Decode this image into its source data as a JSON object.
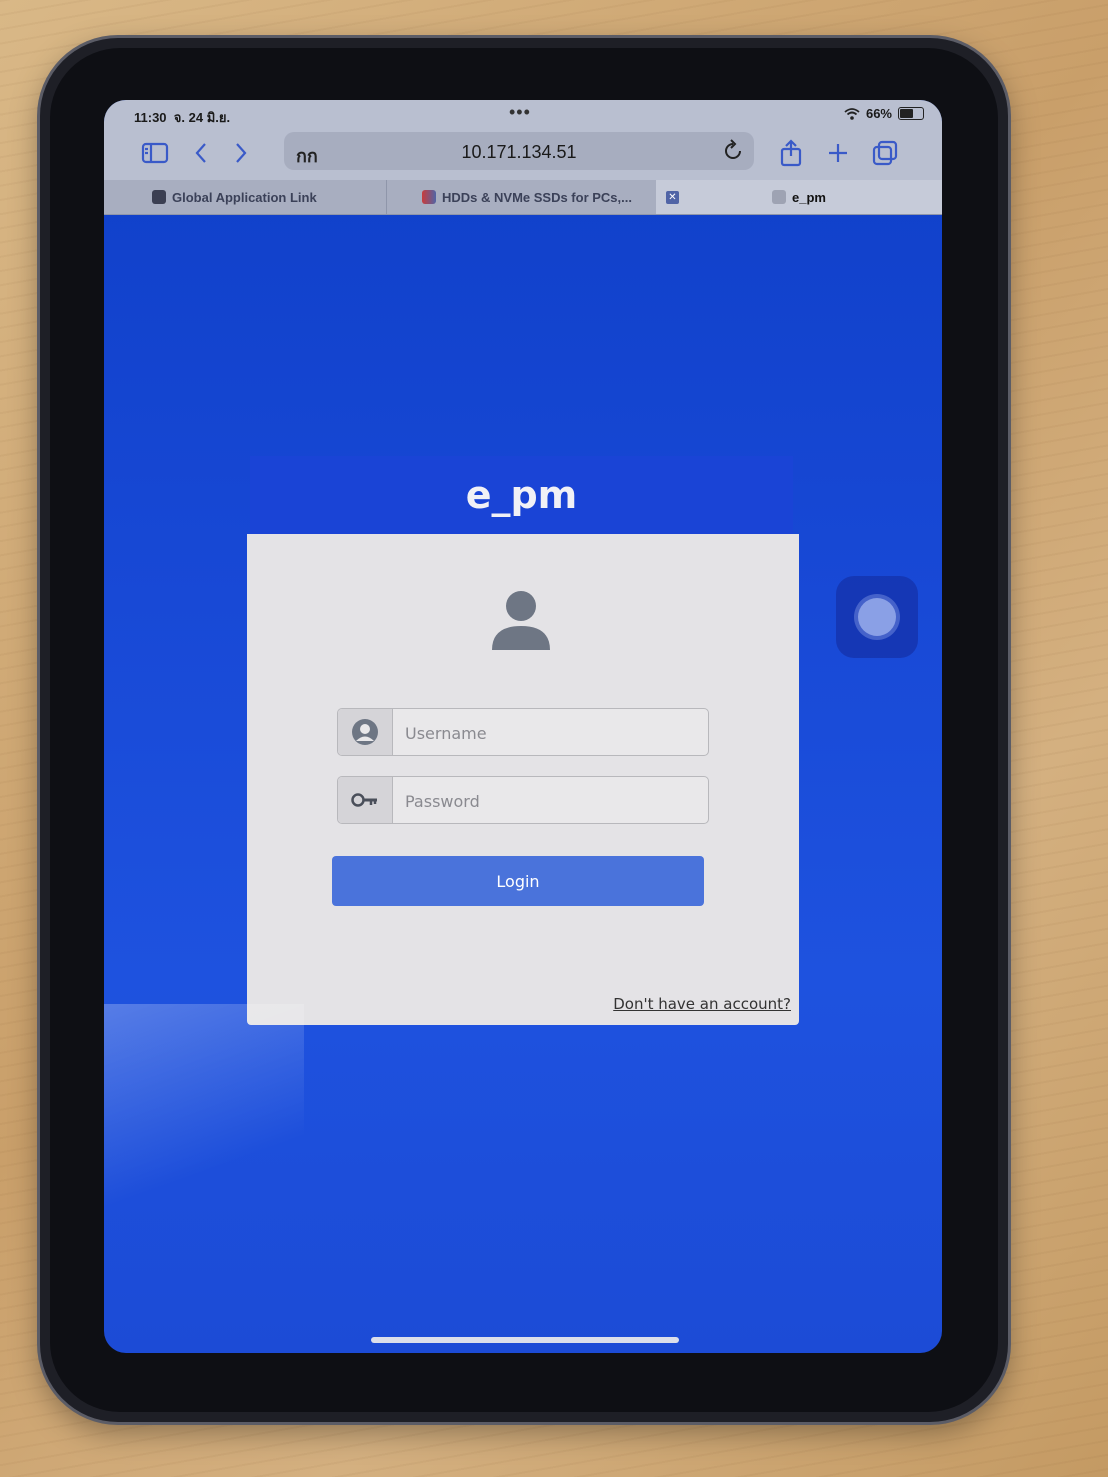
{
  "status": {
    "time": "11:30",
    "date": "จ. 24 มิ.ย.",
    "dots": "•••",
    "battery": "66%"
  },
  "browser": {
    "reader_label": "กก",
    "url": "10.171.134.51",
    "tabs": [
      {
        "label": "Global Application Link"
      },
      {
        "label": "HDDs & NVMe SSDs for PCs,..."
      },
      {
        "label": "e_pm"
      }
    ],
    "tab_close": "✕"
  },
  "login": {
    "title": "e_pm",
    "username_placeholder": "Username",
    "password_placeholder": "Password",
    "login_label": "Login",
    "signup_link": "Don't have an account?"
  },
  "colors": {
    "page_background": "#1a48d8",
    "header": "#1a44d6",
    "button": "#4a73db",
    "card": "#e4e3e6"
  }
}
